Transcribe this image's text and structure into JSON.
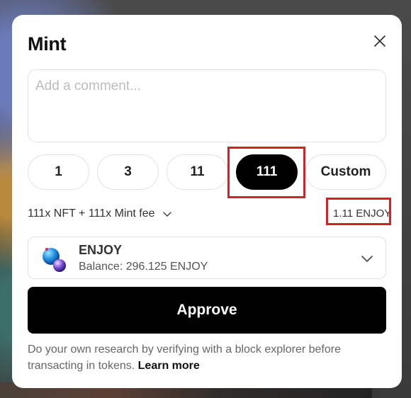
{
  "modal": {
    "title": "Mint",
    "close_icon": "close-icon"
  },
  "comment": {
    "placeholder": "Add a comment...",
    "value": ""
  },
  "quantity": {
    "options": [
      "1",
      "3",
      "11",
      "111",
      "Custom"
    ],
    "selected": "111"
  },
  "fee": {
    "summary": "111x NFT + 111x Mint fee",
    "summary_icon": "chevron-down-icon",
    "total": "1.11 ENJOY"
  },
  "token": {
    "name": "ENJOY",
    "balance": "Balance: 296.125 ENJOY",
    "icon": "enjoy-token-icon",
    "dropdown_icon": "chevron-down-icon"
  },
  "actions": {
    "approve_label": "Approve"
  },
  "disclaimer": {
    "text": "Do your own research by verifying with a block explorer before transacting in tokens.",
    "link": "Learn more"
  },
  "colors": {
    "primary": "#000000",
    "highlight": "#d61f26",
    "border": "#e2e2e2"
  }
}
